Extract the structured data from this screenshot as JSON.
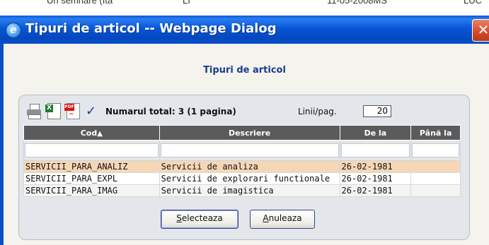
{
  "background": {
    "fragments": [
      "Un semnare (Ita",
      "LI",
      "11-05-2008MS",
      "LUC"
    ]
  },
  "window": {
    "title": "Tipuri de articol -- Webpage Dialog",
    "icon": "ie-icon",
    "close_glyph": "✕"
  },
  "dialog": {
    "heading": "Tipuri de articol"
  },
  "toolbar": {
    "icons": [
      "print-icon",
      "excel-export-icon",
      "pdf-export-icon",
      "check-icon"
    ],
    "excel_badge": "X",
    "pdf_badge": "PDF",
    "check_glyph": "✓",
    "total_text": "Numarul total: 3 (1 pagina)",
    "page_size_label": "Linii/pag.",
    "page_size_value": "20"
  },
  "grid": {
    "columns": [
      "Cod",
      "Descriere",
      "De la",
      "Până la"
    ],
    "sort_indicator": "▲",
    "rows": [
      {
        "cod": "SERVICII_PARA_ANALIZ",
        "descriere": "Servicii de analiza",
        "de_la": "26-02-1981",
        "pana_la": "",
        "selected": true
      },
      {
        "cod": "SERVICII_PARA_EXPL",
        "descriere": "Servicii de explorari functionale",
        "de_la": "26-02-1981",
        "pana_la": ""
      },
      {
        "cod": "SERVICII_PARA_IMAG",
        "descriere": "Servicii de imagistica",
        "de_la": "26-02-1981",
        "pana_la": ""
      }
    ],
    "selected_row_color": "#f5d7b6",
    "header_color": "#5b5b5b"
  },
  "buttons": {
    "select": {
      "accesskey": "S",
      "rest": "electeaza"
    },
    "cancel": {
      "accesskey": "A",
      "rest": "nuleaza"
    }
  },
  "colors": {
    "titlebar": "#0856d6",
    "accent_text": "#1a3c8c"
  }
}
